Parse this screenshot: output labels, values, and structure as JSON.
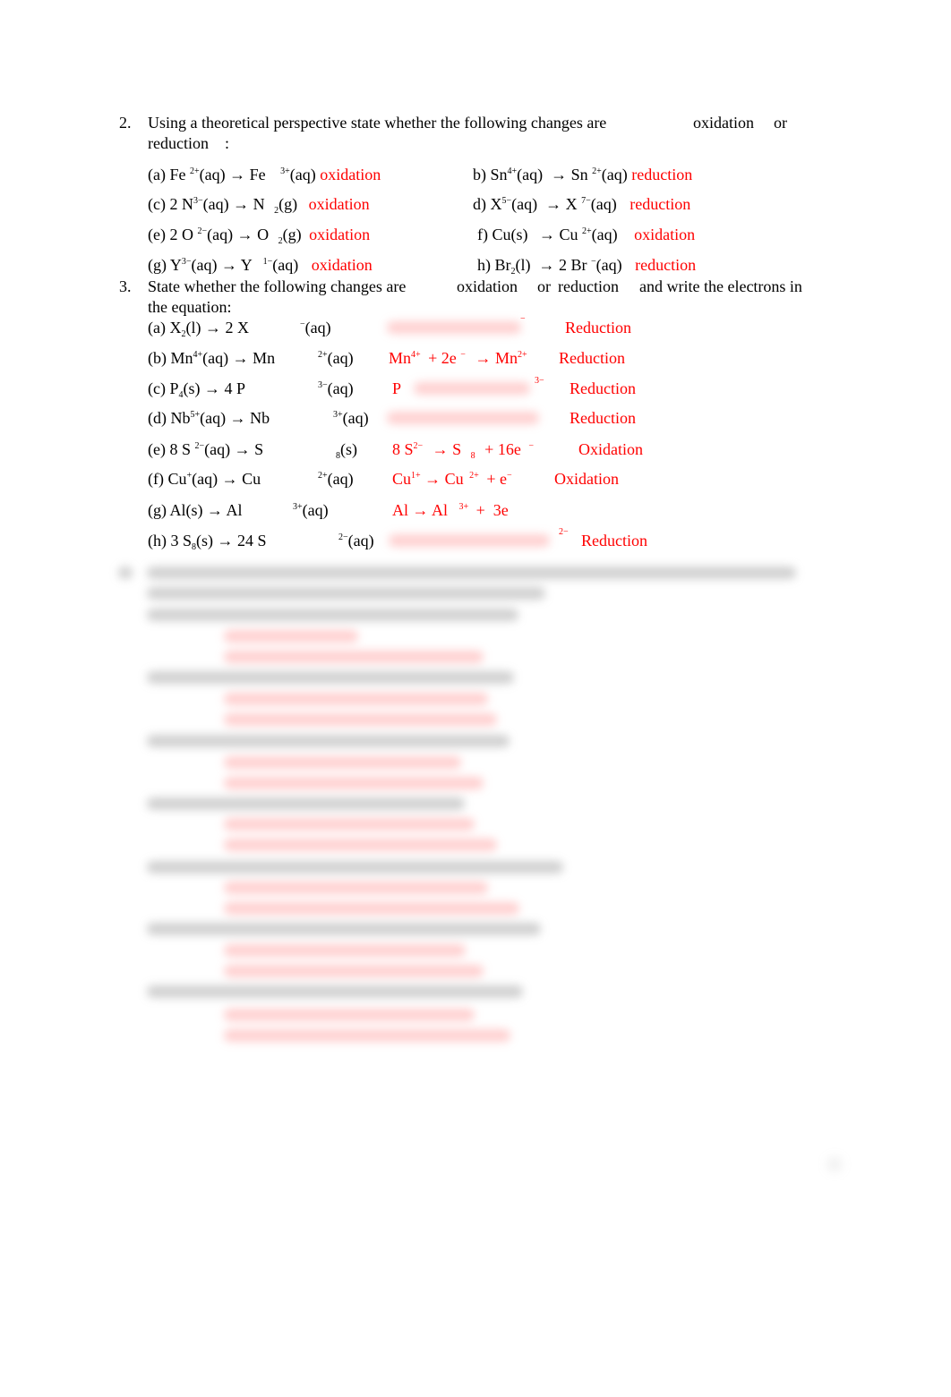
{
  "q2": {
    "number": "2.",
    "prompt_line1": "Using a theoretical perspective state whether the following changes are",
    "kw_oxidation": "oxidation",
    "kw_or": "or",
    "prompt_line2": "reduction",
    "colon": ":",
    "items": [
      {
        "label": "(a) Fe",
        "sup1": "2+",
        "mid": "(aq) → Fe",
        "sup2": "3+",
        "end": "(aq)",
        "answer": "oxidation"
      },
      {
        "label": "b) Sn",
        "sup1": "4+",
        "mid": "(aq)  → Sn",
        "sup2": "2+",
        "end": "(aq)",
        "answer": "reduction"
      },
      {
        "label": "(c) 2 N",
        "sup1": "3−",
        "mid": "(aq) → N",
        "sub2": "2",
        "end": "(g)",
        "answer": "oxidation"
      },
      {
        "label": "d) X",
        "sup1": "5−",
        "mid": "(aq)  → X",
        "sup2": "7−",
        "end": "(aq)",
        "answer": "reduction"
      },
      {
        "label": "(e) 2 O",
        "sup1": "2−",
        "mid": "(aq) → O",
        "sub2": "2",
        "end": "(g)",
        "answer": "oxidation"
      },
      {
        "label": "f) Cu(s)",
        "mid": "→ Cu",
        "sup2": "2+",
        "end": "(aq)",
        "answer": "oxidation"
      },
      {
        "label": "(g) Y",
        "sup1": "3−",
        "mid": "(aq) → Y",
        "sup2": "1−",
        "end": "(aq)",
        "answer": "oxidation"
      },
      {
        "label": "h) Br",
        "sub1": "2",
        "mid": "(l)  → 2 Br",
        "sup2": "−",
        "end": "(aq)",
        "answer": "reduction"
      }
    ]
  },
  "q3": {
    "number": "3.",
    "prompt_a": "State whether the following changes are",
    "kw_oxidation": "oxidation",
    "kw_or": "or",
    "kw_reduction": "reduction",
    "prompt_b": "and write the electrons in",
    "prompt_line2": "the equation:",
    "items": [
      {
        "label": "(a) X",
        "sub1": "2",
        "mid": "(l) → 2 X",
        "sup2": "−",
        "end": "(aq)",
        "eq_visible": "",
        "eq_sup": "−",
        "answer": "Reduction"
      },
      {
        "label": "(b) Mn",
        "sup1": "4+",
        "mid": "(aq) → Mn",
        "sup2": "2+",
        "end": "(aq)",
        "eq_parts": [
          "Mn",
          "4+",
          "+ 2e",
          "−",
          "→ Mn",
          "2+"
        ],
        "answer": "Reduction"
      },
      {
        "label": "(c) P",
        "sub1": "4",
        "mid": "(s) → 4 P",
        "sup2": "3−",
        "end": "(aq)",
        "eq_visible": "P",
        "eq_sup": "3−",
        "answer": "Reduction"
      },
      {
        "label": "(d) Nb",
        "sup1": "5+",
        "mid": "(aq) → Nb",
        "sup2": "3+",
        "end": "(aq)",
        "eq_visible": "",
        "answer": "Reduction"
      },
      {
        "label": "(e) 8 S",
        "sup1": "2−",
        "mid": "(aq) → S",
        "sub2": "8",
        "end": "(s)",
        "eq_parts": [
          "8 S",
          "2−",
          "→ S",
          "8",
          "+ 16e",
          "−"
        ],
        "answer": "Oxidation"
      },
      {
        "label": "(f) Cu",
        "sup1": "+",
        "mid": "(aq) → Cu",
        "sup2": "2+",
        "end": "(aq)",
        "eq_parts": [
          "Cu",
          "1+",
          "→ Cu",
          "2+",
          "+ e",
          "−"
        ],
        "answer": "Oxidation"
      },
      {
        "label": "(g) Al(s) → Al",
        "sup2": "3+",
        "end": "(aq)",
        "eq_parts": [
          "Al → Al",
          "3+",
          "+  3e"
        ],
        "answer": ""
      },
      {
        "label": "(h) 3 S",
        "sub1": "8",
        "mid": "(s) → 24 S",
        "sup2": "2−",
        "end": "(aq)",
        "eq_visible": "",
        "eq_sup": "2−",
        "answer": "Reduction"
      }
    ]
  },
  "q4": {
    "state": "blurred"
  },
  "colors": {
    "answer": "#ff0000",
    "text": "#000000"
  }
}
